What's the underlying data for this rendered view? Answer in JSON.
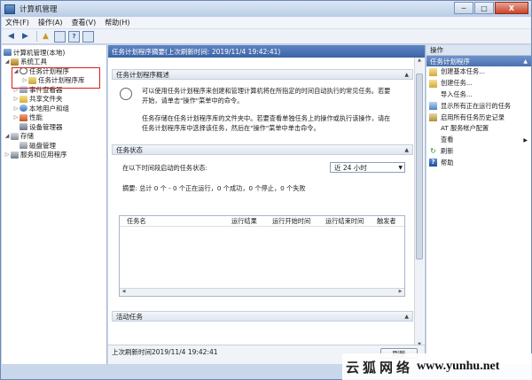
{
  "window": {
    "title": "计算机管理"
  },
  "window_buttons": {
    "minimize": "─",
    "maximize": "□",
    "close": "X"
  },
  "menu": [
    "文件(F)",
    "操作(A)",
    "查看(V)",
    "帮助(H)"
  ],
  "toolbar_icons": [
    "back-arrow-icon",
    "forward-arrow-icon",
    "up-folder-icon",
    "show-hide-tree-icon",
    "help-icon",
    "properties-icon"
  ],
  "tree": {
    "root": "计算机管理(本地)",
    "system_tools": "系统工具",
    "task_scheduler": "任务计划程序",
    "task_library": "任务计划程序库",
    "event_viewer": "事件查看器",
    "shared_folders": "共享文件夹",
    "local_users": "本地用户和组",
    "performance": "性能",
    "device_manager": "设备管理器",
    "storage": "存储",
    "disk_management": "磁盘管理",
    "services_apps": "服务和应用程序"
  },
  "center": {
    "header": "任务计划程序摘要(上次刷新时间: 2019/11/4 19:42:41)",
    "overview_title": "任务计划程序概述",
    "overview_p1_l1": "可以使用任务计划程序来创建和管理计算机将在所指定的时间自动执行的常见任务。若要",
    "overview_p1_l2": "开始，请单击\"操作\"菜单中的命令。",
    "overview_p2_l1": "任务存储在任务计划程序库的文件夹中。若要查看单独任务上的操作或执行该操作，请在",
    "overview_p2_l2": "任务计划程序库中选择该任务，然后在\"操作\"菜单中单击命令。",
    "status_title": "任务状态",
    "status_label": "在以下时间段启动的任务状态:",
    "period_value": "近 24 小时",
    "summary": "摘要: 总计 0 个 - 0 个正在运行，0 个成功，0 个停止，0 个失败",
    "columns": [
      "任务名",
      "运行结果",
      "运行开始时间",
      "运行结束时间",
      "触发者"
    ],
    "active_title": "活动任务",
    "last_refresh": "上次刷新时间2019/11/4 19:42:41",
    "refresh_button": "刷新"
  },
  "actions": {
    "header": "操作",
    "section": "任务计划程序",
    "items": [
      {
        "label": "创建基本任务...",
        "icon": "create-basic-task-icon"
      },
      {
        "label": "创建任务...",
        "icon": "create-task-icon"
      },
      {
        "label": "导入任务...",
        "icon": "import-task-icon"
      },
      {
        "label": "显示所有正在运行的任务",
        "icon": "running-tasks-icon"
      },
      {
        "label": "启用所有任务历史记录",
        "icon": "task-history-icon"
      },
      {
        "label": "AT 服务帐户配置",
        "icon": "at-service-icon"
      },
      {
        "label": "查看",
        "icon": "view-icon"
      },
      {
        "label": "刷新",
        "icon": "refresh-icon"
      },
      {
        "label": "帮助",
        "icon": "help-icon"
      }
    ]
  },
  "watermark": {
    "cn": "云狐网络",
    "url": "www.yunhu.net"
  }
}
